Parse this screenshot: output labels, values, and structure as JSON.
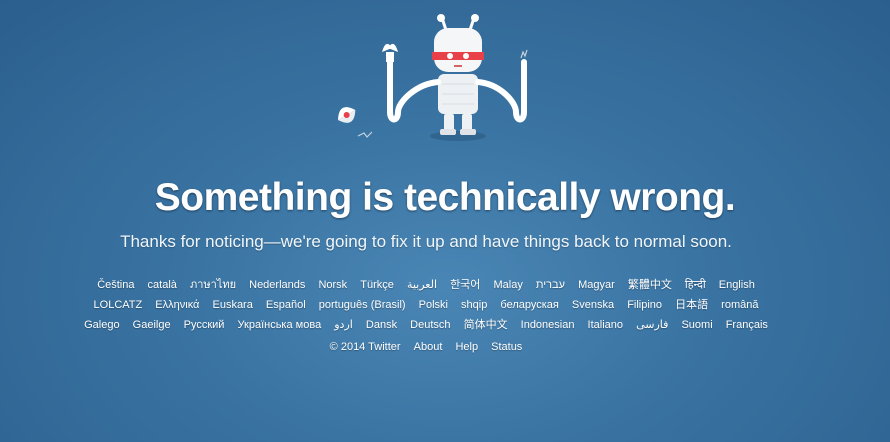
{
  "headline": "Something is technically wrong.",
  "subline": "Thanks for noticing—we're going to fix it up and have things back to normal soon.",
  "languages": {
    "rows": [
      [
        "Čeština",
        "català",
        "ภาษาไทย",
        "Nederlands",
        "Norsk",
        "Türkçe",
        "العربية",
        "한국어",
        "Malay",
        "עברית",
        "Magyar",
        "繁體中文",
        "हिन्दी",
        "English"
      ],
      [
        "LOLCATZ",
        "Ελληνικά",
        "Euskara",
        "Español",
        "português (Brasil)",
        "Polski",
        "shqip",
        "беларуская",
        "Svenska",
        "Filipino",
        "日本語",
        "română"
      ],
      [
        "Galego",
        "Gaeilge",
        "Русский",
        "Українська мова",
        "اردو",
        "Dansk",
        "Deutsch",
        "简体中文",
        "Indonesian",
        "Italiano",
        "فارسی",
        "Suomi",
        "Français"
      ]
    ]
  },
  "footer": {
    "copyright": "© 2014 Twitter",
    "about": "About",
    "help": "Help",
    "status": "Status"
  },
  "colors": {
    "background": "#3a74a3",
    "robot_body": "#ffffff",
    "robot_bandage": "#e8414a"
  }
}
